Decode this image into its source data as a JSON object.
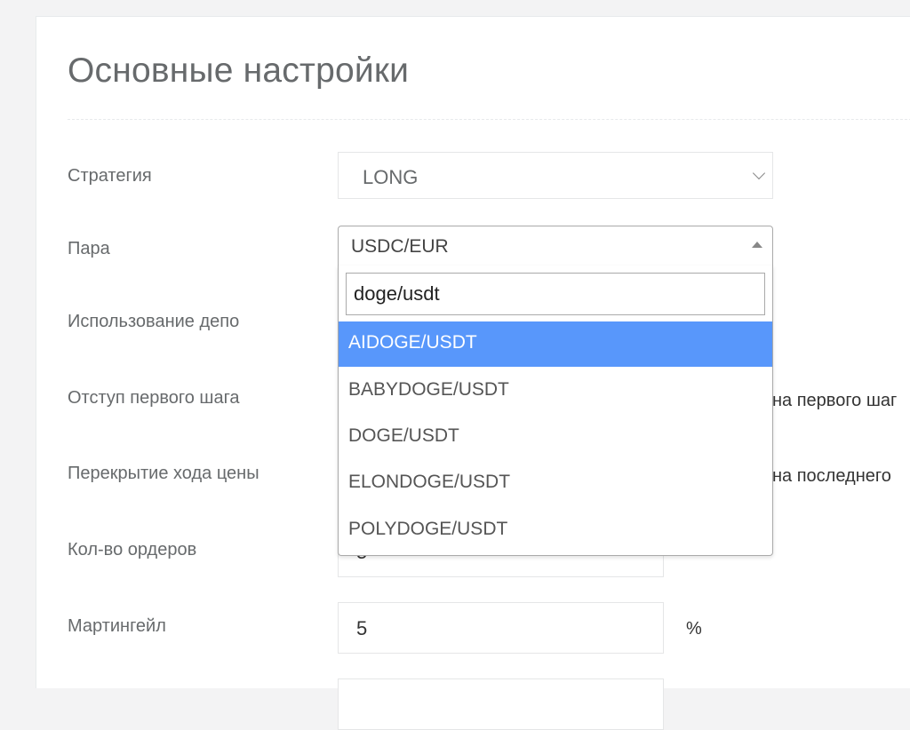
{
  "page": {
    "title": "Основные настройки"
  },
  "fields": {
    "strategy": {
      "label": "Стратегия",
      "value": "LONG"
    },
    "pair": {
      "label": "Пара",
      "value": "USDC/EUR",
      "search": "doge/usdt",
      "options": [
        "AIDOGE/USDT",
        "BABYDOGE/USDT",
        "DOGE/USDT",
        "ELONDOGE/USDT",
        "POLYDOGE/USDT"
      ],
      "highlighted": "AIDOGE/USDT"
    },
    "deposit_usage": {
      "label": "Использование депо"
    },
    "first_step_offset": {
      "label": "Отступ первого шага",
      "side_text": "на первого шаг"
    },
    "price_overlap": {
      "label": "Перекрытие хода цены",
      "side_text": "на последнего"
    },
    "orders_count": {
      "label": "Кол-во ордеров",
      "value": "5"
    },
    "martingale": {
      "label": "Мартингейл",
      "value": "5",
      "unit": "%"
    }
  },
  "colors": {
    "highlight": "#5897fb",
    "label": "#676a6c",
    "background": "#f3f3f4"
  }
}
